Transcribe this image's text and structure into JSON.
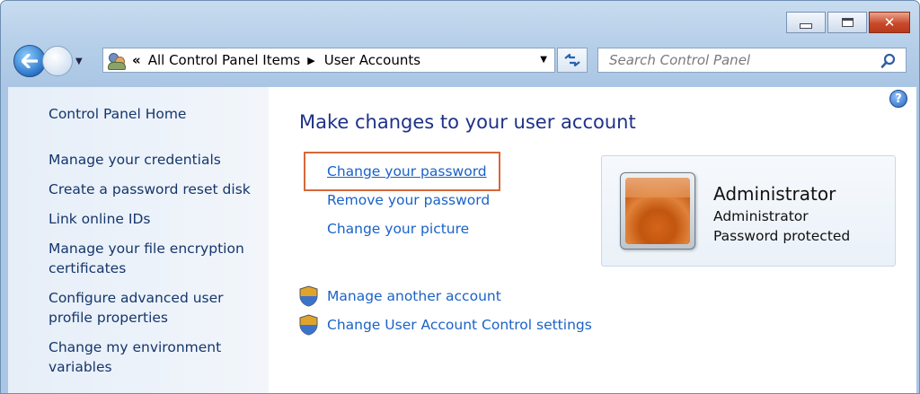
{
  "window": {
    "caption_buttons": {
      "close_symbol": "✕"
    }
  },
  "toolbar": {
    "back_icon": "back-arrow-icon",
    "forward_icon": "forward-arrow-icon",
    "address": {
      "chevron": "«",
      "crumbs": [
        "All Control Panel Items",
        "User Accounts"
      ]
    },
    "search_placeholder": "Search Control Panel"
  },
  "sidebar": {
    "items": [
      {
        "label": "Control Panel Home"
      },
      {
        "label": "Manage your credentials"
      },
      {
        "label": "Create a password reset disk"
      },
      {
        "label": "Link online IDs"
      },
      {
        "label": "Manage your file encryption certificates"
      },
      {
        "label": "Configure advanced user profile properties"
      },
      {
        "label": "Change my environment variables"
      }
    ]
  },
  "main": {
    "title": "Make changes to your user account",
    "tasks": [
      {
        "label": "Change your password"
      },
      {
        "label": "Remove your password"
      },
      {
        "label": "Change your picture"
      }
    ],
    "shield_tasks": [
      {
        "label": "Manage another account"
      },
      {
        "label": "Change User Account Control settings"
      }
    ],
    "user": {
      "name": "Administrator",
      "role": "Administrator",
      "status": "Password protected"
    },
    "help_symbol": "?"
  },
  "colors": {
    "link": "#1a62c7",
    "title": "#1e3287",
    "highlight": "#d6683a"
  }
}
